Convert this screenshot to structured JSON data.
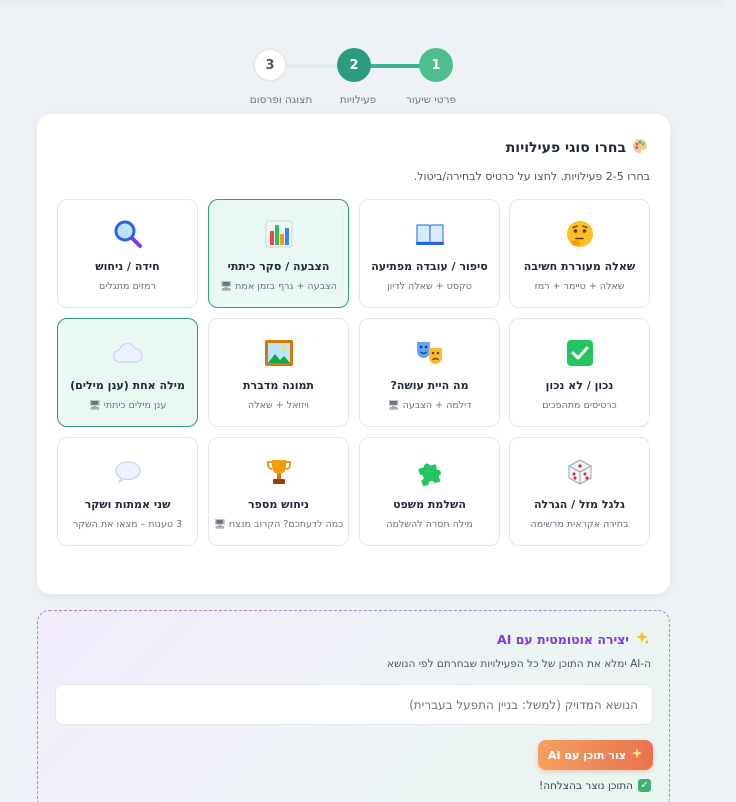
{
  "stepper": {
    "steps": [
      {
        "num": "1",
        "label": "פרטי שיעור"
      },
      {
        "num": "2",
        "label": "פעילויות"
      },
      {
        "num": "3",
        "label": "תצוגה ופרסום"
      }
    ]
  },
  "activities": {
    "title": "בחרו סוגי פעילויות",
    "title_icon": "palette-icon",
    "subtitle": "בחרו 2-5 פעילויות. לחצו על כרטיס לבחירה/ביטול.",
    "tiles": [
      {
        "name": "שאלה מעוררת חשיבה",
        "desc": "שאלה + טיימר + רמז",
        "icon": "thinking-face-icon",
        "selected": false
      },
      {
        "name": "סיפור / עובדה מפתיעה",
        "desc": "טקסט + שאלה לדיון",
        "icon": "open-book-icon",
        "selected": false
      },
      {
        "name": "הצבעה / סקר כיתתי",
        "desc": "הצבעה + גרף בזמן אמת 🖥",
        "icon": "bar-chart-icon",
        "selected": true
      },
      {
        "name": "חידה / ניחוש",
        "desc": "רמזים מתגלים",
        "icon": "magnifier-icon",
        "selected": false
      },
      {
        "name": "נכון / לא נכון",
        "desc": "כרטיסים מתהפכים",
        "icon": "check-box-icon",
        "selected": false
      },
      {
        "name": "מה היית עושה?",
        "desc": "דילמה + הצבעה 🖥",
        "icon": "theater-masks-icon",
        "selected": false
      },
      {
        "name": "תמונה מדברת",
        "desc": "ויזואל + שאלה",
        "icon": "framed-picture-icon",
        "selected": false
      },
      {
        "name": "מילה אחת (ענן מילים)",
        "desc": "ענן מילים כיתתי 🖥",
        "icon": "cloud-icon",
        "selected": true
      },
      {
        "name": "גלגל מזל / הגרלה",
        "desc": "בחירה אקראית מרשימה",
        "icon": "dice-icon",
        "selected": false
      },
      {
        "name": "השלמת משפט",
        "desc": "מילה חסרה להשלמה",
        "icon": "puzzle-piece-icon",
        "selected": false
      },
      {
        "name": "ניחוש מספר",
        "desc": "כמה לדעתכם? הקרוב מנצח 🖥",
        "icon": "trophy-icon",
        "selected": false
      },
      {
        "name": "שני אמתות ושקר",
        "desc": "3 טענות – מצאו את השקר",
        "icon": "speech-bubble-icon",
        "selected": false
      }
    ]
  },
  "ai": {
    "title": "יצירה אוטומטית עם AI",
    "subtitle": "ה-AI ימלא את התוכן של כל הפעילויות שבחרתם לפי הנושא",
    "input_placeholder": "הנושא המדויק (למשל: בניין התפעל בעברית)",
    "input_value": "",
    "button_label": "צור תוכן עם AI",
    "success_text": "התוכן נוצר בהצלחה!"
  }
}
